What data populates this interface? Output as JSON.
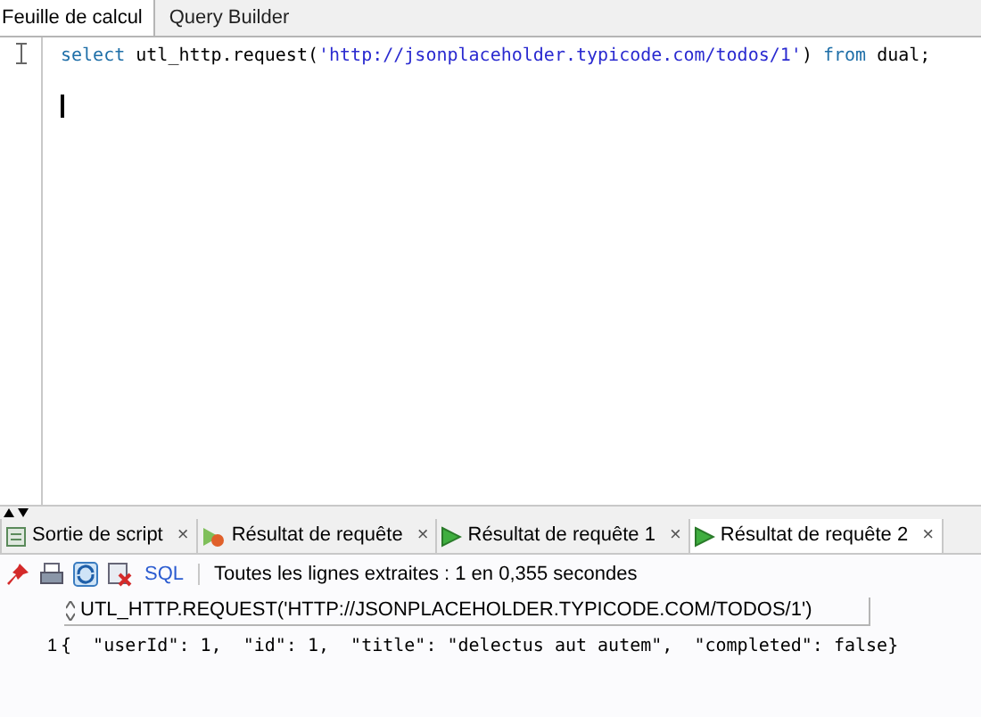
{
  "editor_tabs": [
    {
      "label": "Feuille de calcul",
      "selected": true
    },
    {
      "label": "Query Builder",
      "selected": false
    }
  ],
  "code_tokens": [
    {
      "kind": "keyword",
      "text": "select"
    },
    {
      "kind": "plain",
      "text": " utl_http.request("
    },
    {
      "kind": "string",
      "text": "'http://jsonplaceholder.typicode.com/todos/1'"
    },
    {
      "kind": "plain",
      "text": ") "
    },
    {
      "kind": "keyword",
      "text": "from"
    },
    {
      "kind": "plain",
      "text": " dual;"
    }
  ],
  "result_tabs": [
    {
      "label": "Sortie de script",
      "kind": "script",
      "close": "×",
      "selected": false
    },
    {
      "label": "Résultat de requête",
      "kind": "error",
      "close": "×",
      "selected": false
    },
    {
      "label": "Résultat de requête 1",
      "kind": "play",
      "close": "×",
      "selected": false
    },
    {
      "label": "Résultat de requête 2",
      "kind": "play",
      "close": "×",
      "selected": true
    }
  ],
  "toolbar": {
    "sql_label": "SQL",
    "status": "Toutes les lignes extraites : 1 en 0,355 secondes"
  },
  "grid": {
    "column": "UTL_HTTP.REQUEST('HTTP://JSONPLACEHOLDER.TYPICODE.COM/TODOS/1')",
    "rows": [
      {
        "number": "1",
        "value": "{  \"userId\": 1,  \"id\": 1,  \"title\": \"delectus aut autem\",  \"completed\": false}"
      }
    ]
  }
}
